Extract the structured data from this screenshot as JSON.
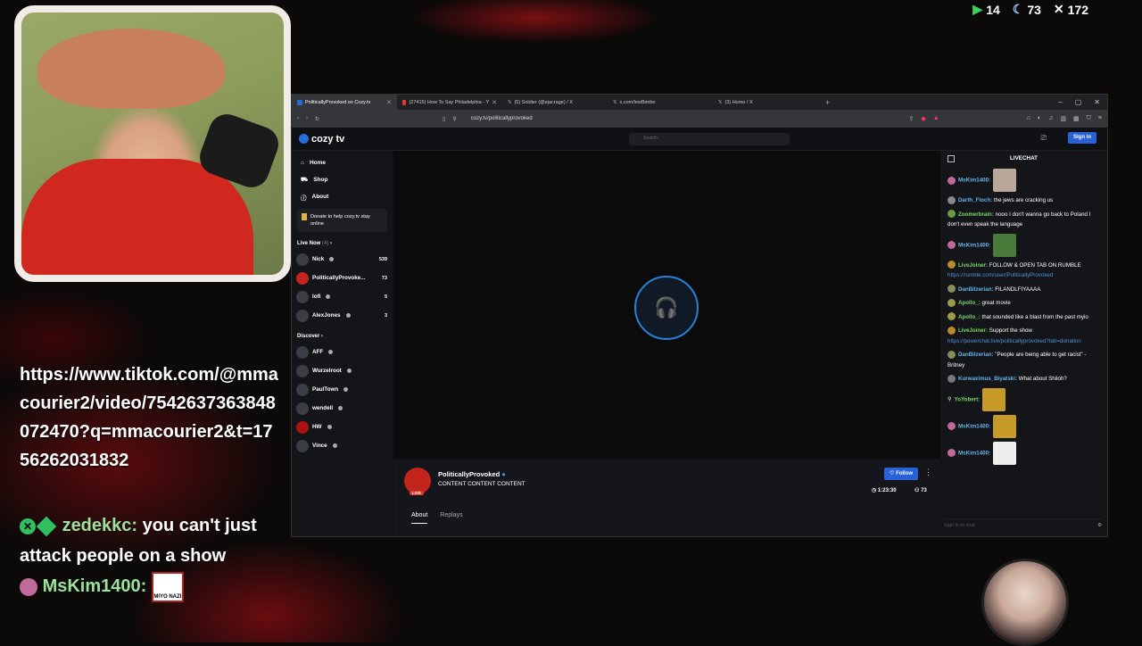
{
  "stats": {
    "play": "14",
    "moon": "73",
    "x": "172"
  },
  "overlay": {
    "link_text": "https://www.tiktok.com/@mmacourier2/video/7542637363848072470?q=mmacourier2&t=1756262031832",
    "chat": [
      {
        "user": "zedekkc:",
        "text": "you can't just attack people on a show"
      },
      {
        "user": "MsKim1400:",
        "emote": "MIYO NAZI"
      }
    ]
  },
  "browser": {
    "tabs": [
      {
        "label": "PoliticallyProvoked on Cozy.tv"
      },
      {
        "label": "(27415) How To Say Philadelphia - Y"
      },
      {
        "label": "(5) Soldier (@ejacrage) / X"
      },
      {
        "label": "x.com/lewBimbo"
      },
      {
        "label": "(3) Home / X"
      }
    ],
    "url": "cozy.tv/politicallyprovoked"
  },
  "site": {
    "logo": "cozy tv",
    "search_placeholder": "Search",
    "sign_in": "Sign in",
    "nav": [
      {
        "label": "Home",
        "icon": "home-icon"
      },
      {
        "label": "Shop",
        "icon": "shop-icon"
      },
      {
        "label": "About",
        "icon": "info-icon"
      }
    ],
    "donate": "Donate to help cozy.tv stay online",
    "live_now": {
      "title": "Live Now",
      "count": "(4)"
    },
    "live_channels": [
      {
        "name": "Nick",
        "viewers": "539"
      },
      {
        "name": "PoliticallyProvoke...",
        "viewers": "73"
      },
      {
        "name": "lofi",
        "viewers": "5"
      },
      {
        "name": "AlexJones",
        "viewers": "3"
      }
    ],
    "discover": {
      "title": "Discover"
    },
    "discover_channels": [
      {
        "name": "AFF"
      },
      {
        "name": "Wurzelroot"
      },
      {
        "name": "PaulTown"
      },
      {
        "name": "wendell"
      },
      {
        "name": "HW"
      },
      {
        "name": "Vince"
      }
    ],
    "stream": {
      "name": "PoliticallyProvoked",
      "title": "CONTENT CONTENT CONTENT",
      "live": "LIVE",
      "follow": "Follow",
      "duration": "1:23:30",
      "viewers": "73",
      "tabs": [
        "About",
        "Replays"
      ]
    },
    "chat": {
      "title": "LIVECHAT",
      "input_placeholder": "Sign in to chat",
      "messages": [
        {
          "user": "MsKim1400:",
          "text": "",
          "emote": true
        },
        {
          "user": "Darth_Floch:",
          "text": "the jews are cracking us"
        },
        {
          "user": "Zoomerbrain:",
          "text": "nooo I don't wanna go back to Poland I don't even speak the language",
          "green": true
        },
        {
          "user": "MsKim1400:",
          "text": "",
          "emote": true
        },
        {
          "user": "LiveJoiner:",
          "text": "FOLLOW & OPEN TAB ON RUMBLE",
          "link": "https://rumble.com/user/PoliticallyProvoked",
          "green": true
        },
        {
          "user": "DanBilzerian:",
          "text": "FILANDLFIYAAAA"
        },
        {
          "user": "Apollo_:",
          "text": "great movie",
          "green": true
        },
        {
          "user": "Apollo_:",
          "text": "that sounded like a blast from the past myio",
          "green": true
        },
        {
          "user": "LiveJoiner:",
          "text": "Support the show",
          "link": "https://powerchat.live/politicallyprovoked?tab=donation",
          "green": true
        },
        {
          "user": "DanBilzerian:",
          "text": "\"People are being able to get racist\" -Britney"
        },
        {
          "user": "Kurwaximus_Biyatski:",
          "text": "What about Shiloh?"
        },
        {
          "user": "YoYobert:",
          "text": "",
          "emote": true,
          "green": true
        },
        {
          "user": "MsKim1400:",
          "text": "",
          "emote": true
        },
        {
          "user": "MsKim1400:",
          "text": "",
          "emote": true
        }
      ]
    }
  }
}
